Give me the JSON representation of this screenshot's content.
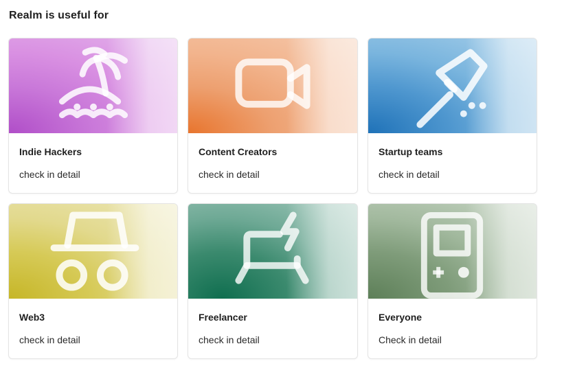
{
  "heading": "Realm is useful for",
  "cards": [
    {
      "title": "Indie Hackers",
      "link": "check in detail",
      "icon": "island-palm-icon",
      "colors": [
        "#b04ec8",
        "#d58be0",
        "#e7c4ef"
      ]
    },
    {
      "title": "Content Creators",
      "link": "check in detail",
      "icon": "video-camera-icon",
      "colors": [
        "#e8752e",
        "#f1b38b",
        "#f6d9c6"
      ]
    },
    {
      "title": "Startup teams",
      "link": "check in detail",
      "icon": "rocket-icon",
      "colors": [
        "#1f72b8",
        "#6fb0dc",
        "#c7e2f1"
      ]
    },
    {
      "title": "Web3",
      "link": "check in detail",
      "icon": "incognito-icon",
      "colors": [
        "#c6b627",
        "#e0d886",
        "#f1eec8"
      ]
    },
    {
      "title": "Freelancer",
      "link": "check in detail",
      "icon": "laptop-bolt-icon",
      "colors": [
        "#0f6e4f",
        "#66a992",
        "#c5ddd5"
      ]
    },
    {
      "title": "Everyone",
      "link": "Check in detail",
      "icon": "gameboy-icon",
      "colors": [
        "#5d7f58",
        "#98b294",
        "#d2ddd0"
      ]
    }
  ]
}
